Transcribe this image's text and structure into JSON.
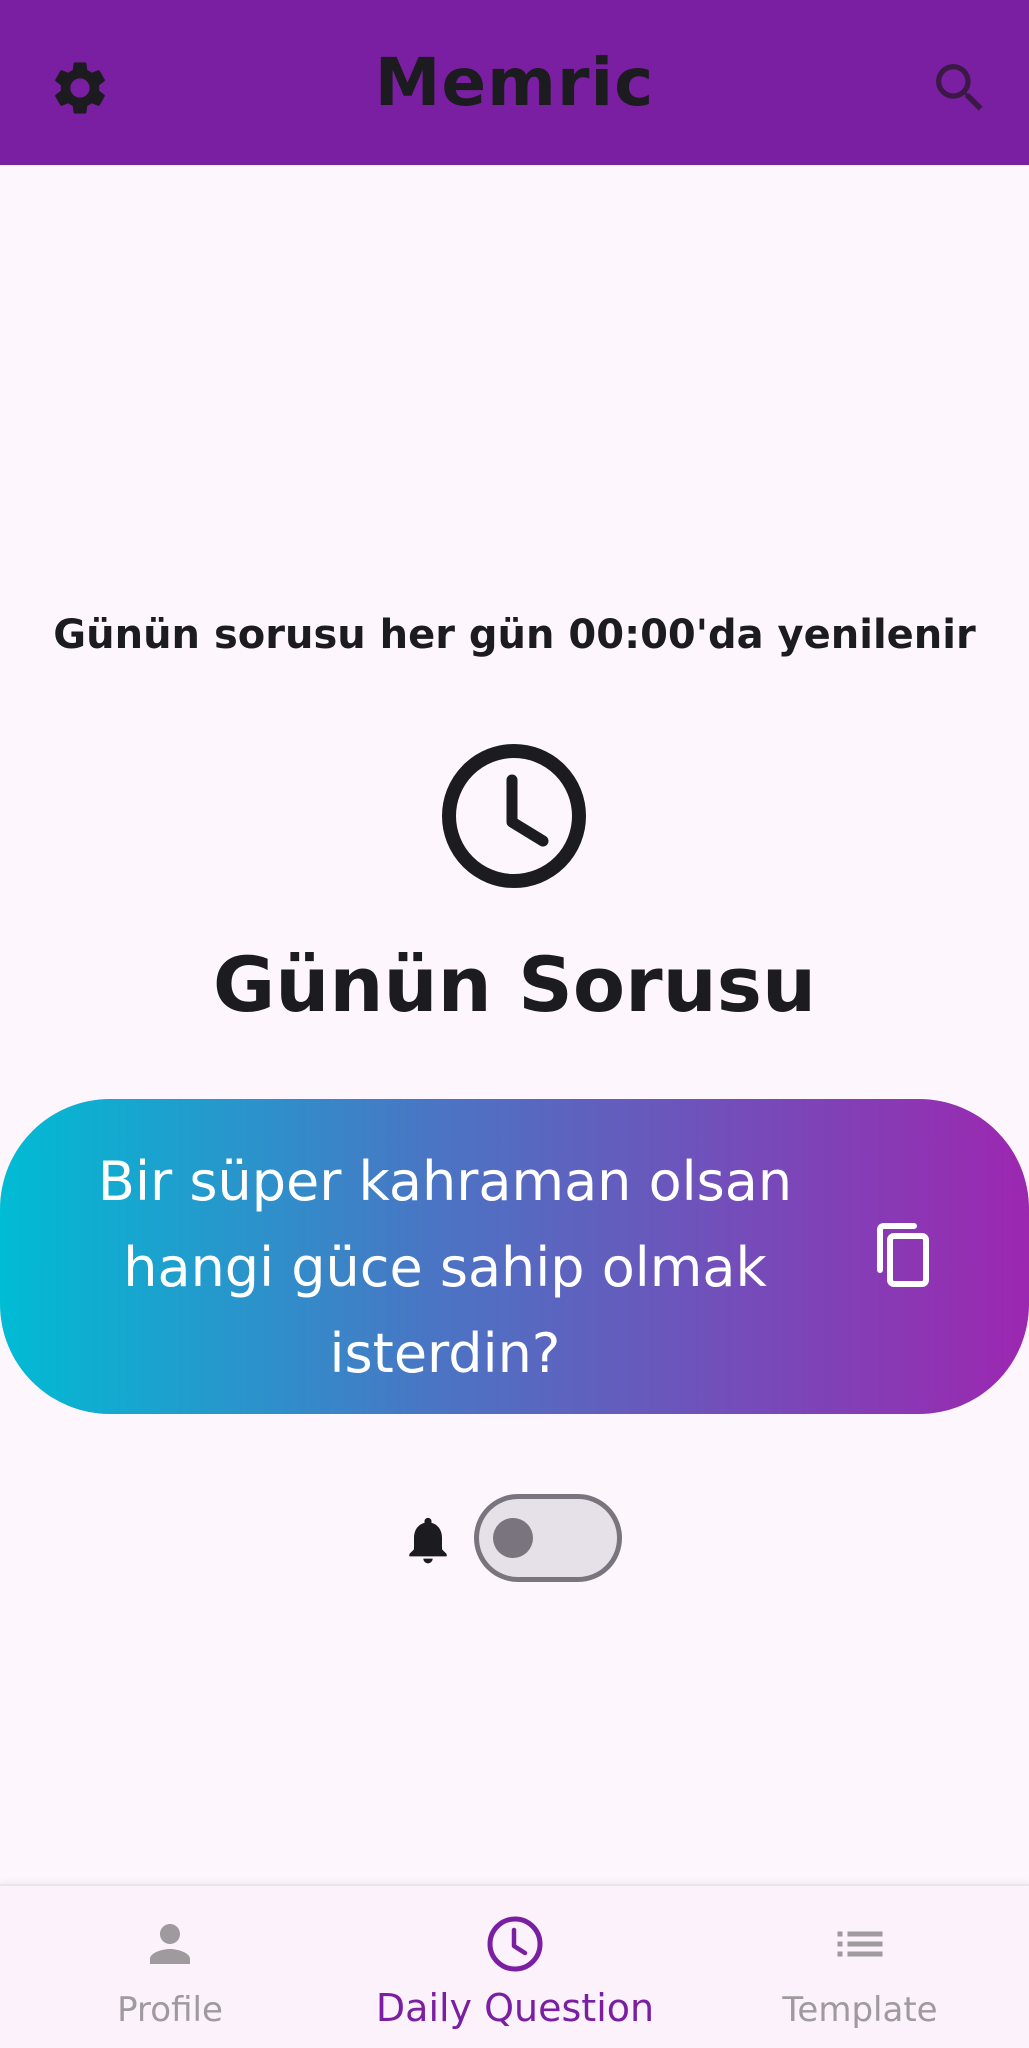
{
  "app_bar": {
    "title": "Memric",
    "settings_icon": "gear-icon",
    "search_icon": "search-icon"
  },
  "main": {
    "subtitle": "Günün sorusu her gün 00:00'da yenilenir",
    "clock_icon": "clock-icon",
    "question_title": "Günün Sorusu",
    "question_text": "Bir süper kahraman olsan hangi güce sahip olmak isterdin?",
    "copy_icon": "copy-icon",
    "notification_icon": "bell-icon",
    "notification_enabled": false
  },
  "bottom_nav": {
    "items": [
      {
        "label": "Profile",
        "icon": "person-icon",
        "selected": false
      },
      {
        "label": "Daily Question",
        "icon": "clock-icon",
        "selected": true
      },
      {
        "label": "Template",
        "icon": "list-icon",
        "selected": false
      }
    ]
  },
  "colors": {
    "app_bar": "#7b1fa2",
    "background": "#fdf6fc",
    "accent": "#7b1fa2",
    "gradient_start": "#00bcd4",
    "gradient_end": "#9c27b0",
    "nav_inactive": "#9e9a9e"
  }
}
